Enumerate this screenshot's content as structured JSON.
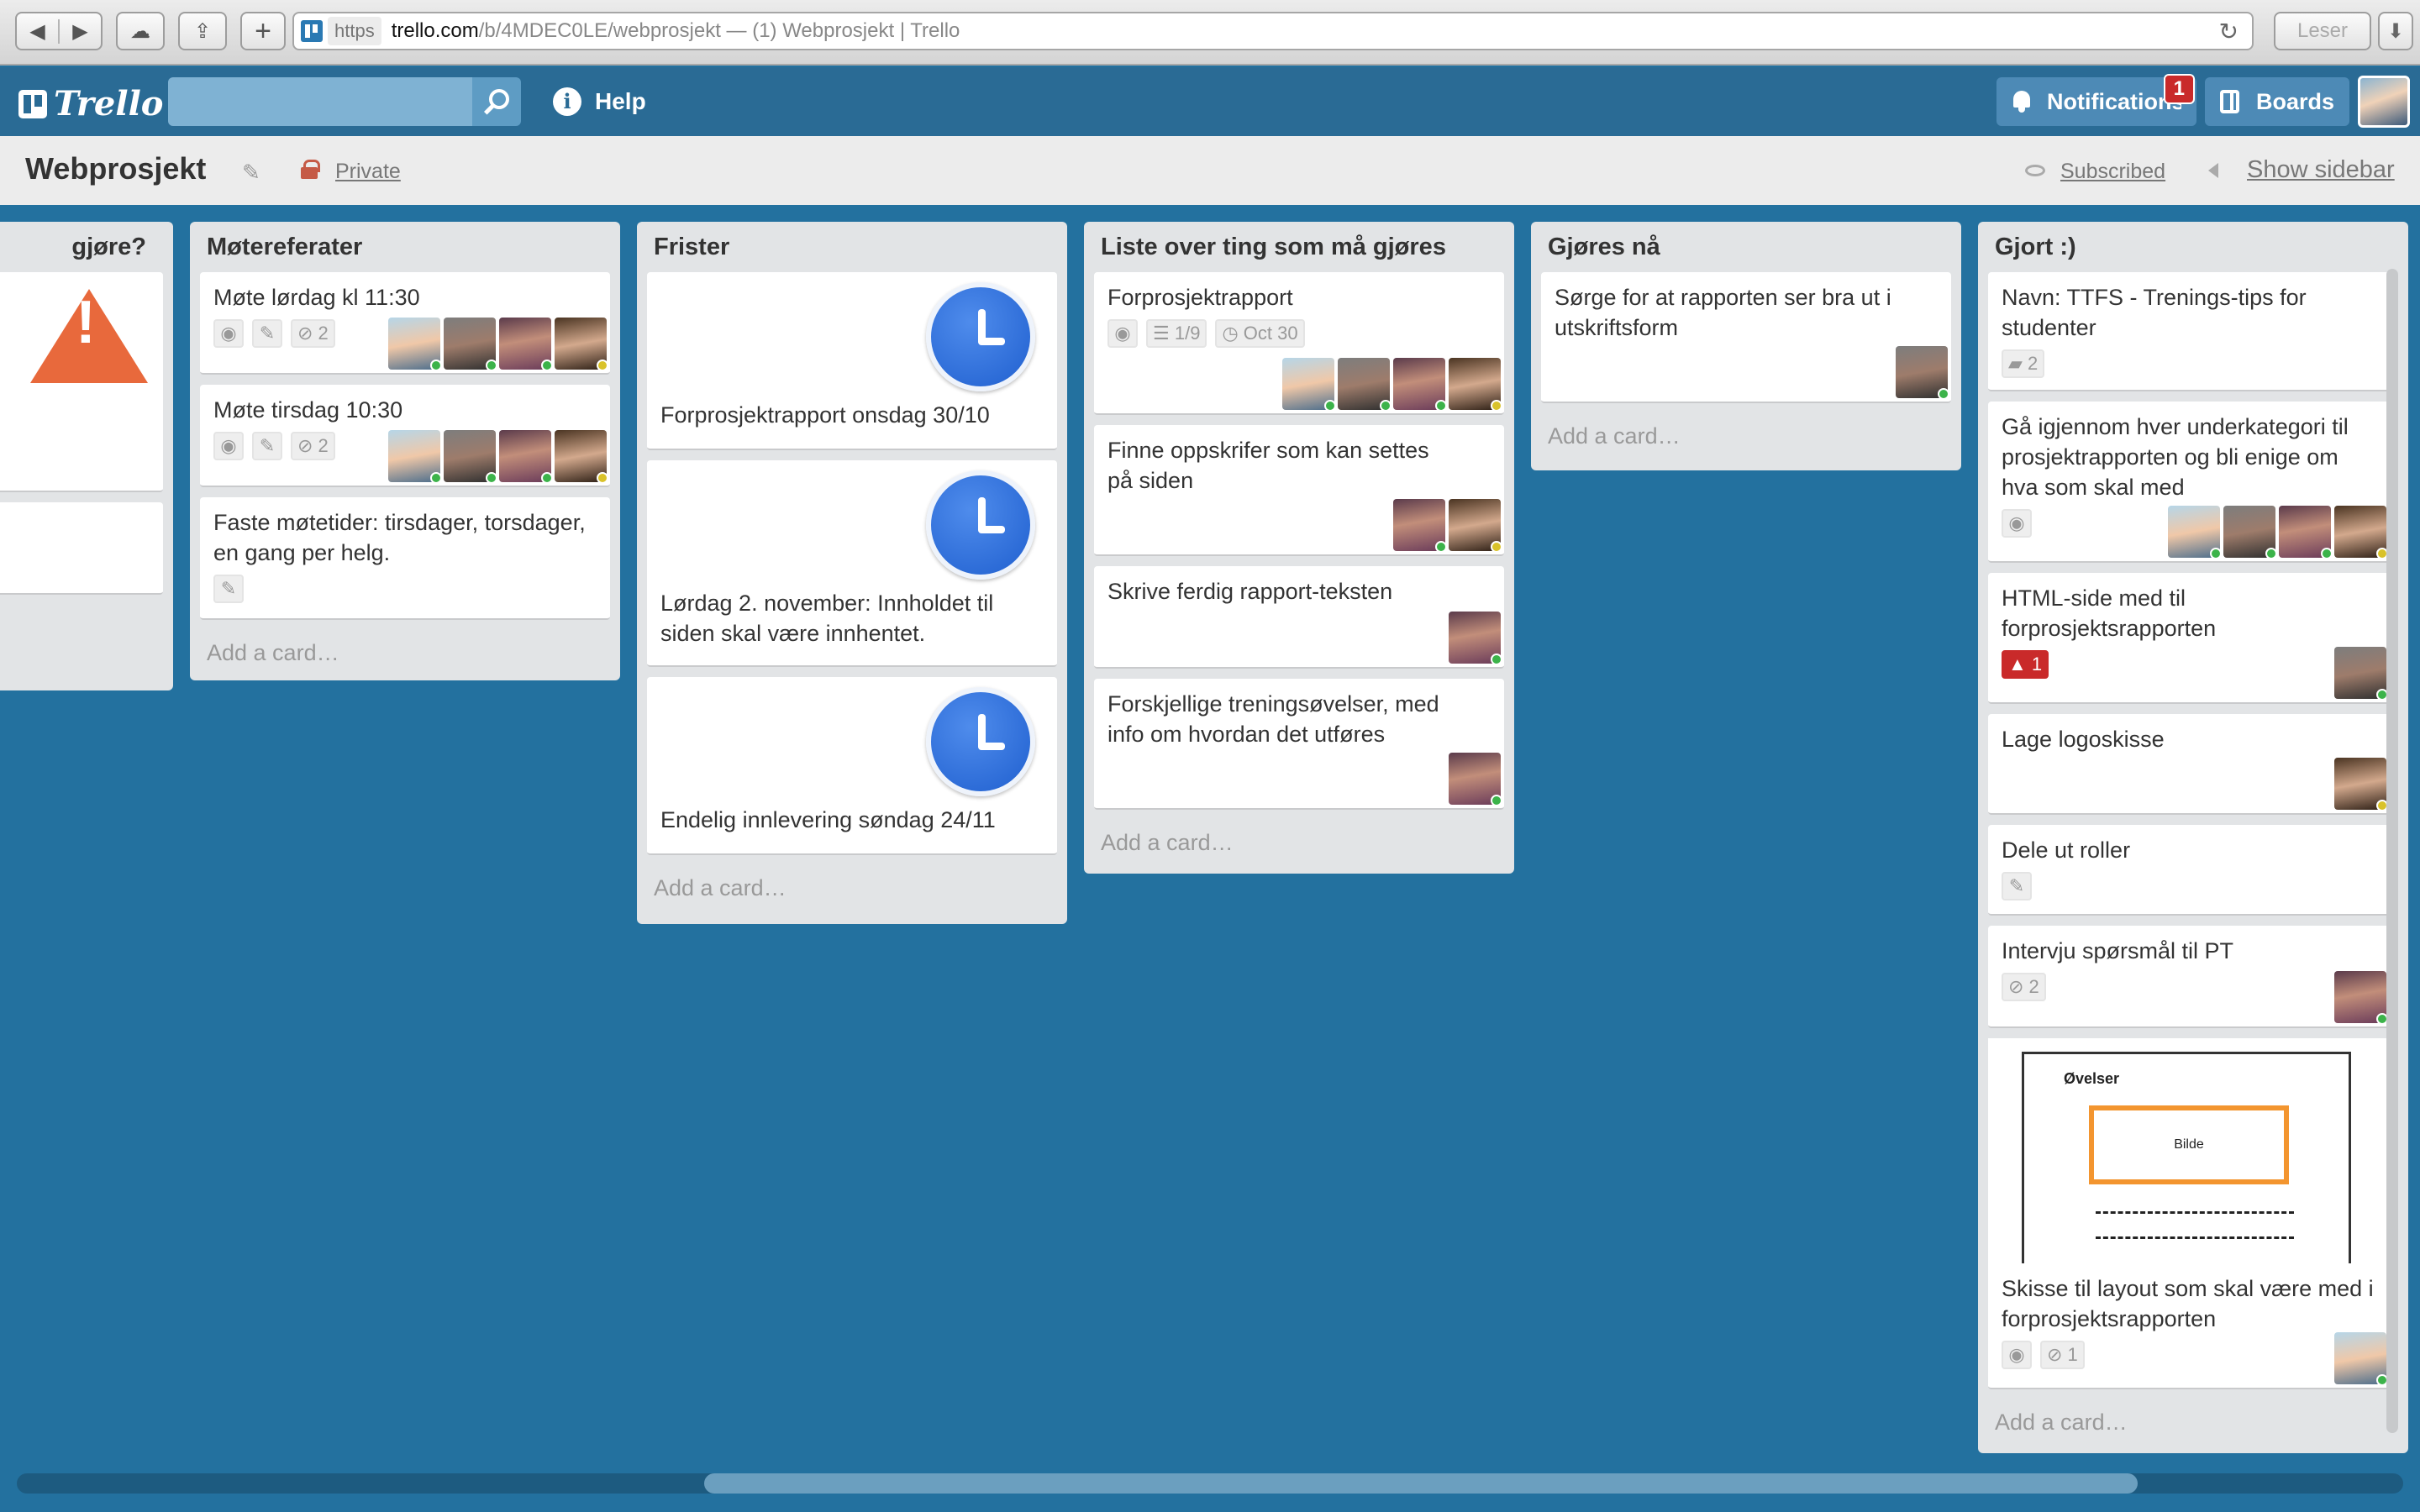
{
  "browser": {
    "https": "https",
    "domain": "trello.com",
    "path": "/b/4MDEC0LE/webprosjekt — (1) Webprosjekt | Trello",
    "reader": "Leser"
  },
  "header": {
    "logo": "Trello",
    "help": "Help",
    "notifications_label": "Notifications",
    "notifications_count": "1",
    "boards_label": "Boards"
  },
  "board": {
    "title": "Webprosjekt",
    "visibility": "Private",
    "subscribed": "Subscribed",
    "show_sidebar": "Show sidebar"
  },
  "add_card": "Add a card…",
  "lists": {
    "partial": {
      "title": "gjøre?"
    },
    "motereferater": {
      "title": "Møtereferater",
      "cards": [
        {
          "title": "Møte lørdag kl 11:30",
          "attachments": "2"
        },
        {
          "title": "Møte tirsdag 10:30",
          "attachments": "2"
        },
        {
          "title": "Faste møtetider: tirsdager, torsdager, en gang per helg."
        }
      ]
    },
    "frister": {
      "title": "Frister",
      "cards": [
        {
          "title": "Forprosjektrapport onsdag 30/10"
        },
        {
          "title": "Lørdag 2. november: Innholdet til siden skal være innhentet."
        },
        {
          "title": "Endelig innlevering søndag 24/11"
        }
      ]
    },
    "liste": {
      "title": "Liste over ting som må gjøres",
      "cards": [
        {
          "title": "Forprosjektrapport",
          "checklist": "1/9",
          "due": "Oct 30"
        },
        {
          "title": "Finne oppskrifer som kan settes på siden"
        },
        {
          "title": "Skrive ferdig rapport-teksten"
        },
        {
          "title": "Forskjellige treningsøvelser, med info om hvordan det utføres"
        }
      ]
    },
    "gjores_na": {
      "title": "Gjøres nå",
      "cards": [
        {
          "title": "Sørge for at rapporten ser bra ut i utskriftsform"
        }
      ]
    },
    "gjort": {
      "title": "Gjort :)",
      "cards": [
        {
          "title": "Navn: TTFS - Trenings-tips for studenter",
          "comments": "2"
        },
        {
          "title": "Gå igjennom hver underkategori til prosjektrapporten og bli enige om hva som skal med"
        },
        {
          "title": "HTML-side med til forprosjektsrapporten",
          "notifications": "1"
        },
        {
          "title": "Lage logoskisse"
        },
        {
          "title": "Dele ut roller"
        },
        {
          "title": "Intervju spørsmål til PT",
          "attachments": "2"
        },
        {
          "title": "Skisse til layout som skal være med i forprosjektsrapporten",
          "attachments": "1",
          "sketch": {
            "heading": "Øvelser",
            "box_label": "Bilde"
          }
        }
      ]
    }
  }
}
